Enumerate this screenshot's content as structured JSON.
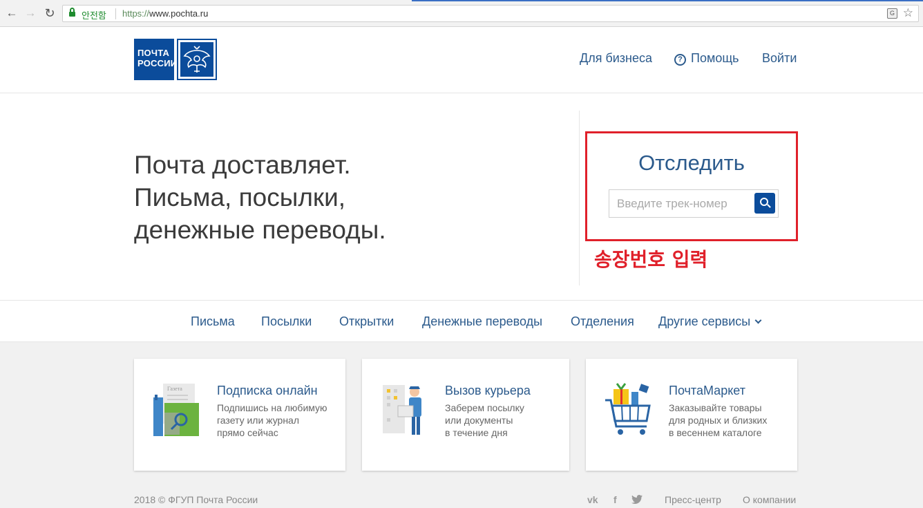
{
  "browser": {
    "secure_label": "안전함",
    "url_scheme": "https://",
    "url_host": "www.pochta.ru",
    "translate_label": "G"
  },
  "header": {
    "logo_text_line1": "ПОЧТА",
    "logo_text_line2": "РОССИИ",
    "links": {
      "business": "Для бизнеса",
      "help": "Помощь",
      "login": "Войти"
    },
    "help_glyph": "?"
  },
  "hero": {
    "line1": "Почта доставляет.",
    "line2": "Письма, посылки,",
    "line3": "денежные переводы."
  },
  "tracking": {
    "title": "Отследить",
    "placeholder": "Введите трек-номер",
    "value": "",
    "annotation": "송장번호 입력",
    "highlight_color": "#e0202a"
  },
  "nav": {
    "items": [
      "Письма",
      "Посылки",
      "Открытки",
      "Денежные переводы",
      "Отделения",
      "Другие сервисы"
    ]
  },
  "cards": [
    {
      "title": "Подписка онлайн",
      "desc": "Подпишись на любимую\nгазету или журнал\nпрямо сейчас",
      "illus_text": "Газета"
    },
    {
      "title": "Вызов курьера",
      "desc": "Заберем посылку\nили документы\nв течение дня"
    },
    {
      "title": "ПочтаМаркет",
      "desc": "Заказывайте товары\nдля родных и близких\nв весеннем каталоге"
    }
  ],
  "footer": {
    "copyright": "2018 © ФГУП Почта России",
    "social": [
      "vk",
      "f"
    ],
    "links": [
      "Пресс-центр",
      "О компании"
    ]
  },
  "colors": {
    "brand_blue": "#0b4c9b",
    "link_blue": "#2b5a8c",
    "annotation_red": "#e0202a"
  }
}
